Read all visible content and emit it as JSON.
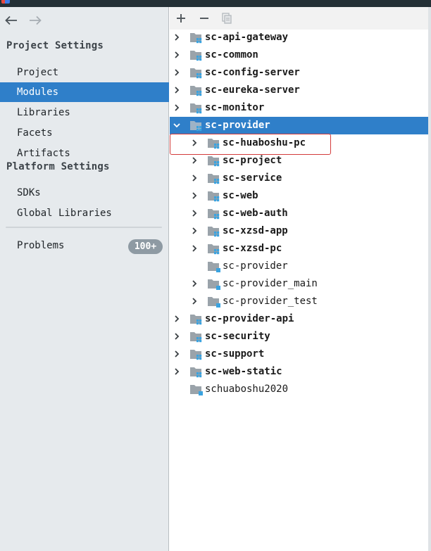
{
  "sidebar": {
    "sections": {
      "project_settings": "Project Settings",
      "platform_settings": "Platform Settings"
    },
    "project_items": [
      {
        "label": "Project",
        "active": false
      },
      {
        "label": "Modules",
        "active": true
      },
      {
        "label": "Libraries",
        "active": false
      },
      {
        "label": "Facets",
        "active": false
      },
      {
        "label": "Artifacts",
        "active": false
      }
    ],
    "platform_items": [
      {
        "label": "SDKs"
      },
      {
        "label": "Global Libraries"
      }
    ],
    "problems": {
      "label": "Problems",
      "count": "100+"
    }
  },
  "toolbar": {
    "add_icon": "plus-icon",
    "remove_icon": "minus-icon",
    "copy_icon": "copy-icon"
  },
  "tree": [
    {
      "label": "sc-api-gateway",
      "level": 0,
      "expandable": true,
      "expanded": false,
      "bold": true,
      "selected": false
    },
    {
      "label": "sc-common",
      "level": 0,
      "expandable": true,
      "expanded": false,
      "bold": true,
      "selected": false
    },
    {
      "label": "sc-config-server",
      "level": 0,
      "expandable": true,
      "expanded": false,
      "bold": true,
      "selected": false
    },
    {
      "label": "sc-eureka-server",
      "level": 0,
      "expandable": true,
      "expanded": false,
      "bold": true,
      "selected": false
    },
    {
      "label": "sc-monitor",
      "level": 0,
      "expandable": true,
      "expanded": false,
      "bold": true,
      "selected": false
    },
    {
      "label": "sc-provider",
      "level": 0,
      "expandable": true,
      "expanded": true,
      "bold": true,
      "selected": true
    },
    {
      "label": "sc-huaboshu-pc",
      "level": 1,
      "expandable": true,
      "expanded": false,
      "bold": true,
      "selected": false,
      "highlighted": true
    },
    {
      "label": "sc-project",
      "level": 1,
      "expandable": true,
      "expanded": false,
      "bold": true,
      "selected": false
    },
    {
      "label": "sc-service",
      "level": 1,
      "expandable": true,
      "expanded": false,
      "bold": true,
      "selected": false
    },
    {
      "label": "sc-web",
      "level": 1,
      "expandable": true,
      "expanded": false,
      "bold": true,
      "selected": false
    },
    {
      "label": "sc-web-auth",
      "level": 1,
      "expandable": true,
      "expanded": false,
      "bold": true,
      "selected": false
    },
    {
      "label": "sc-xzsd-app",
      "level": 1,
      "expandable": true,
      "expanded": false,
      "bold": true,
      "selected": false
    },
    {
      "label": "sc-xzsd-pc",
      "level": 1,
      "expandable": true,
      "expanded": false,
      "bold": true,
      "selected": false
    },
    {
      "label": "sc-provider",
      "level": 1,
      "expandable": false,
      "expanded": false,
      "bold": false,
      "selected": false
    },
    {
      "label": "sc-provider_main",
      "level": 1,
      "expandable": true,
      "expanded": false,
      "bold": false,
      "selected": false
    },
    {
      "label": "sc-provider_test",
      "level": 1,
      "expandable": true,
      "expanded": false,
      "bold": false,
      "selected": false
    },
    {
      "label": "sc-provider-api",
      "level": 0,
      "expandable": true,
      "expanded": false,
      "bold": true,
      "selected": false
    },
    {
      "label": "sc-security",
      "level": 0,
      "expandable": true,
      "expanded": false,
      "bold": true,
      "selected": false
    },
    {
      "label": "sc-support",
      "level": 0,
      "expandable": true,
      "expanded": false,
      "bold": true,
      "selected": false
    },
    {
      "label": "sc-web-static",
      "level": 0,
      "expandable": true,
      "expanded": false,
      "bold": true,
      "selected": false
    },
    {
      "label": "schuaboshu2020",
      "level": 0,
      "expandable": false,
      "expanded": false,
      "bold": false,
      "selected": false
    }
  ],
  "colors": {
    "accent": "#2f7fc9",
    "sidebar_bg": "#e6eaed",
    "highlight_border": "#d33b3b",
    "module_square": "#3aa3e0"
  }
}
